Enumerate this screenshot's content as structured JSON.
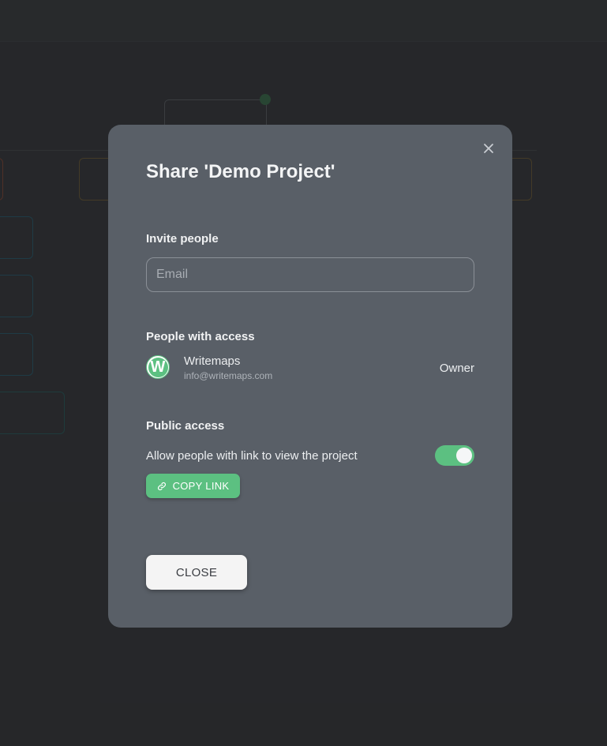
{
  "modal": {
    "title": "Share 'Demo Project'",
    "invite_label": "Invite people",
    "email_placeholder": "Email",
    "email_value": "",
    "access_label": "People with access",
    "people": [
      {
        "avatar_letter": "W",
        "name": "Writemaps",
        "email": "info@writemaps.com",
        "role": "Owner"
      }
    ],
    "public_label": "Public access",
    "public_description": "Allow people with link to view the project",
    "public_enabled": true,
    "copy_link_label": "COPY LINK",
    "close_label": "CLOSE"
  },
  "colors": {
    "accent": "#5cc081",
    "modal_bg": "#595f67",
    "page_bg": "#2b2c2e"
  },
  "icons": {
    "close": "close-icon",
    "link": "link-icon"
  }
}
